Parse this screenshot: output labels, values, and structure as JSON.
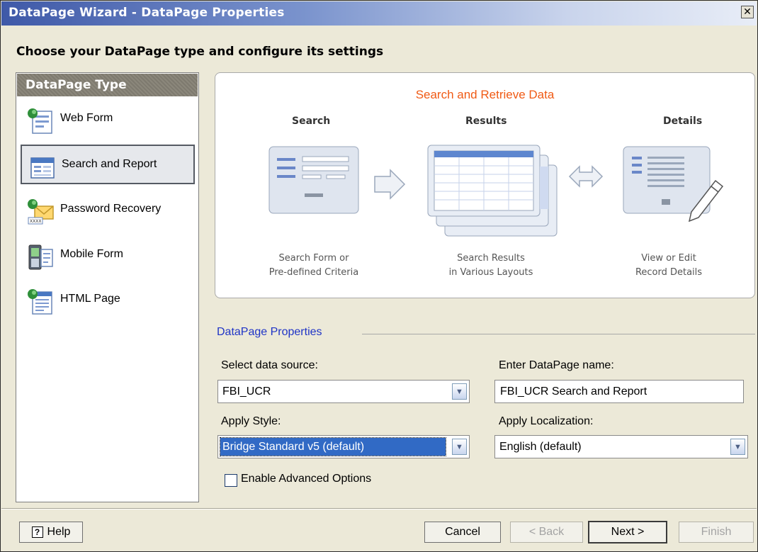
{
  "window": {
    "title": "DataPage Wizard - DataPage Properties",
    "close_icon": "close-icon",
    "subtitle": "Choose your DataPage type and configure its settings"
  },
  "type_panel": {
    "header": "DataPage Type",
    "items": [
      {
        "label": "Web Form",
        "icon": "web-form-icon",
        "selected": false
      },
      {
        "label": "Search and Report",
        "icon": "search-report-icon",
        "selected": true
      },
      {
        "label": "Password Recovery",
        "icon": "password-recovery-icon",
        "selected": false
      },
      {
        "label": "Mobile Form",
        "icon": "mobile-form-icon",
        "selected": false
      },
      {
        "label": "HTML Page",
        "icon": "html-page-icon",
        "selected": false
      }
    ]
  },
  "overview": {
    "title": "Search and Retrieve Data",
    "columns": [
      {
        "head": "Search",
        "caption_line1": "Search Form or",
        "caption_line2": "Pre-defined Criteria"
      },
      {
        "head": "Results",
        "caption_line1": "Search Results",
        "caption_line2": "in Various Layouts"
      },
      {
        "head": "Details",
        "caption_line1": "View or Edit",
        "caption_line2": "Record Details"
      }
    ]
  },
  "properties": {
    "legend": "DataPage Properties",
    "data_source": {
      "label": "Select data source:",
      "value": "FBI_UCR"
    },
    "page_name": {
      "label": "Enter DataPage name:",
      "value": "FBI_UCR Search and Report"
    },
    "style": {
      "label": "Apply Style:",
      "value": "Bridge Standard v5 (default)"
    },
    "localization": {
      "label": "Apply Localization:",
      "value": "English (default)"
    },
    "advanced": {
      "label": "Enable Advanced Options",
      "checked": false
    }
  },
  "buttons": {
    "help": "Help",
    "cancel": "Cancel",
    "back": "< Back",
    "next": "Next >",
    "finish": "Finish"
  },
  "colors": {
    "accent_orange": "#f05a14",
    "legend_blue": "#1f34c6",
    "selection_blue": "#316ac5"
  }
}
